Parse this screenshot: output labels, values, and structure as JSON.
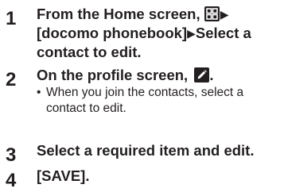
{
  "steps": [
    {
      "number": "1",
      "lines": [
        "From the Home screen,",
        "[docomo phonebook]",
        "Select a",
        "contact to edit."
      ],
      "arrow": "▶"
    },
    {
      "number": "2",
      "text": "On the profile screen,",
      "end": ".",
      "note_bullet": "•",
      "note_line1": "When you join the contacts, select a",
      "note_line2": "contact to edit."
    },
    {
      "number": "3",
      "text": "Select a required item and edit."
    },
    {
      "number": "4",
      "text": "[SAVE]."
    }
  ],
  "icons": {
    "apps": "apps-grid-icon",
    "edit": "edit-pencil-icon"
  },
  "colors": {
    "text": "#231f20",
    "icon_fill": "#231f20",
    "icon_glyph": "#ffffff"
  }
}
